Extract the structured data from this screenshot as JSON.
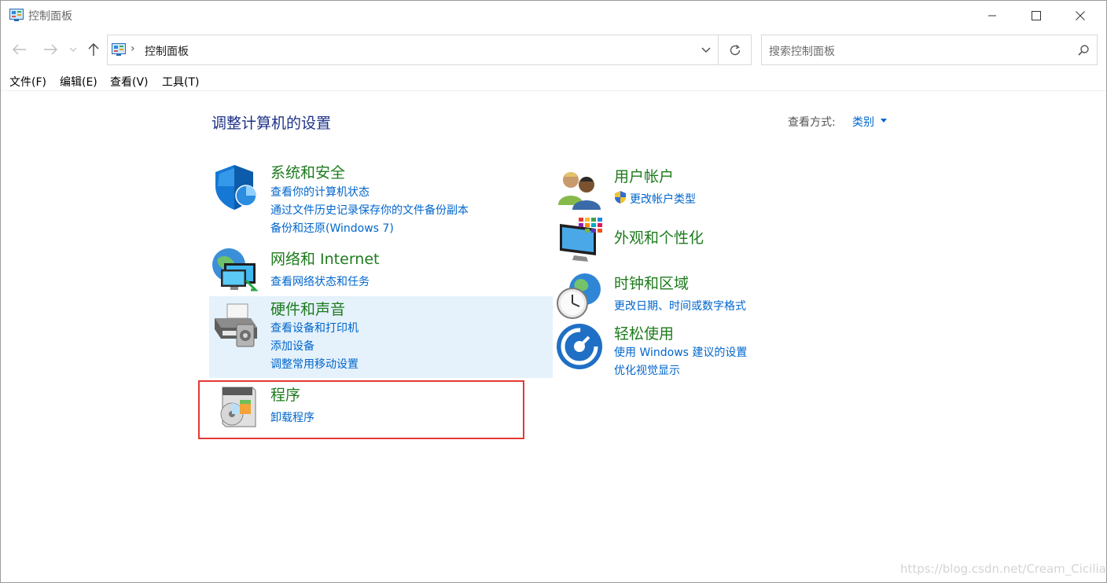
{
  "window": {
    "title": "控制面板",
    "controls": {
      "minimize": "minimize",
      "maximize": "maximize",
      "close": "close"
    }
  },
  "navigation": {
    "address": "控制面板",
    "search_placeholder": "搜索控制面板"
  },
  "menu": [
    "文件(F)",
    "编辑(E)",
    "查看(V)",
    "工具(T)"
  ],
  "main": {
    "title": "调整计算机的设置",
    "view_by_label": "查看方式:",
    "view_by_value": "类别"
  },
  "categories": [
    {
      "title": "系统和安全",
      "icon": "shield-icon",
      "links": [
        "查看你的计算机状态",
        "通过文件历史记录保存你的文件备份副本",
        "备份和还原(Windows 7)"
      ]
    },
    {
      "title": "网络和 Internet",
      "icon": "network-icon",
      "links": [
        "查看网络状态和任务"
      ]
    },
    {
      "title": "硬件和声音",
      "icon": "printer-icon",
      "links": [
        "查看设备和打印机",
        "添加设备",
        "调整常用移动设置"
      ]
    },
    {
      "title": "程序",
      "icon": "programs-icon",
      "links": [
        "卸载程序"
      ]
    },
    {
      "title": "用户帐户",
      "icon": "users-icon",
      "links": [
        "更改帐户类型"
      ]
    },
    {
      "title": "外观和个性化",
      "icon": "monitor-icon",
      "links": []
    },
    {
      "title": "时钟和区域",
      "icon": "clock-icon",
      "links": [
        "更改日期、时间或数字格式"
      ]
    },
    {
      "title": "轻松使用",
      "icon": "ease-of-access-icon",
      "links": [
        "使用 Windows 建议的设置",
        "优化视觉显示"
      ]
    }
  ],
  "watermark": "https://blog.csdn.net/Cream_Cicilian",
  "colors": {
    "category_title": "#1e7b1e",
    "link": "#0066cc",
    "page_title": "#1e3287",
    "hover": "#e5f1fb",
    "highlight": "#e53935"
  }
}
